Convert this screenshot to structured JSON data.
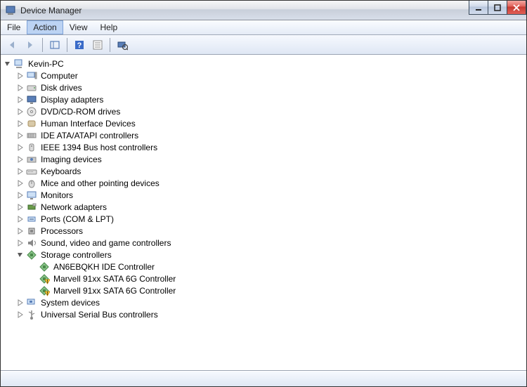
{
  "title": "Device Manager",
  "menu": {
    "file": "File",
    "action": "Action",
    "view": "View",
    "help": "Help"
  },
  "root": {
    "label": "Kevin-PC",
    "categories": [
      {
        "label": "Computer",
        "icon": "computer"
      },
      {
        "label": "Disk drives",
        "icon": "disk"
      },
      {
        "label": "Display adapters",
        "icon": "display"
      },
      {
        "label": "DVD/CD-ROM drives",
        "icon": "cdrom"
      },
      {
        "label": "Human Interface Devices",
        "icon": "hid"
      },
      {
        "label": "IDE ATA/ATAPI controllers",
        "icon": "ide"
      },
      {
        "label": "IEEE 1394 Bus host controllers",
        "icon": "1394"
      },
      {
        "label": "Imaging devices",
        "icon": "imaging"
      },
      {
        "label": "Keyboards",
        "icon": "keyboard"
      },
      {
        "label": "Mice and other pointing devices",
        "icon": "mouse"
      },
      {
        "label": "Monitors",
        "icon": "monitor"
      },
      {
        "label": "Network adapters",
        "icon": "network"
      },
      {
        "label": "Ports (COM & LPT)",
        "icon": "port"
      },
      {
        "label": "Processors",
        "icon": "cpu"
      },
      {
        "label": "Sound, video and game controllers",
        "icon": "sound"
      },
      {
        "label": "Storage controllers",
        "icon": "storage",
        "expanded": true,
        "children": [
          {
            "label": "AN6EBQKH IDE Controller",
            "icon": "storage",
            "warn": false
          },
          {
            "label": "Marvell 91xx SATA 6G Controller",
            "icon": "storage",
            "warn": true
          },
          {
            "label": "Marvell 91xx SATA 6G Controller",
            "icon": "storage",
            "warn": true
          }
        ]
      },
      {
        "label": "System devices",
        "icon": "system"
      },
      {
        "label": "Universal Serial Bus controllers",
        "icon": "usb"
      }
    ]
  }
}
